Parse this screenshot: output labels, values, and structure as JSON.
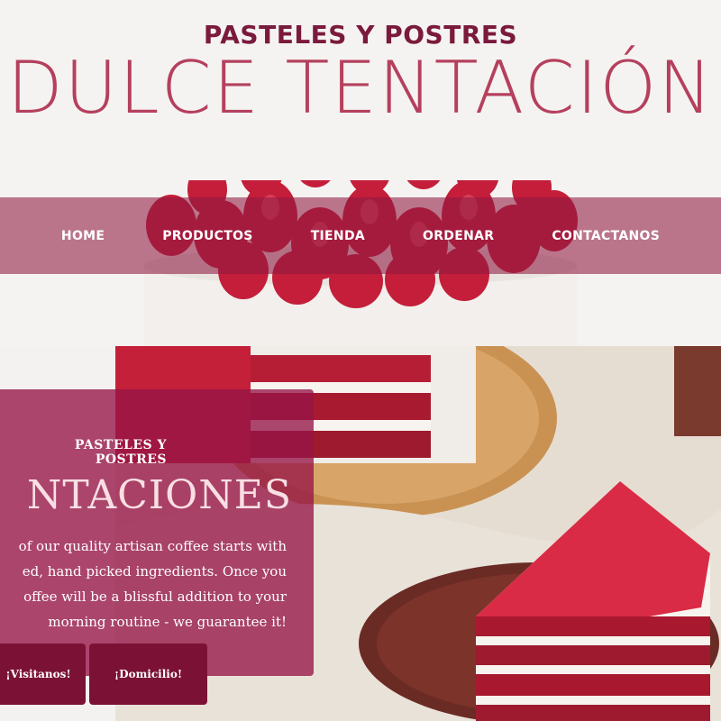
{
  "header": {
    "pre_title": "PASTELES Y POSTRES",
    "title": "DULCE TENTACIÓN"
  },
  "nav": {
    "items": [
      "HOME",
      "PRODUCTOS",
      "TIENDA",
      "ORDENAR",
      "CONTACTANOS"
    ]
  },
  "intro": {
    "subtitle": "PASTELES Y POSTRES",
    "title": "NTACIONES",
    "body": "of our quality artisan coffee starts with\ned, hand picked ingredients. Once you\noffee will be a blissful addition to your\nmorning routine - we guarantee it!",
    "buttons": [
      "¡Visitanos!",
      "¡Domicilio!"
    ]
  },
  "colors": {
    "brand": "#7a1a3c",
    "title": "#b5405e",
    "nav_bg": "#8f1a42",
    "card_bg": "#96144a",
    "button": "#7b1235"
  }
}
